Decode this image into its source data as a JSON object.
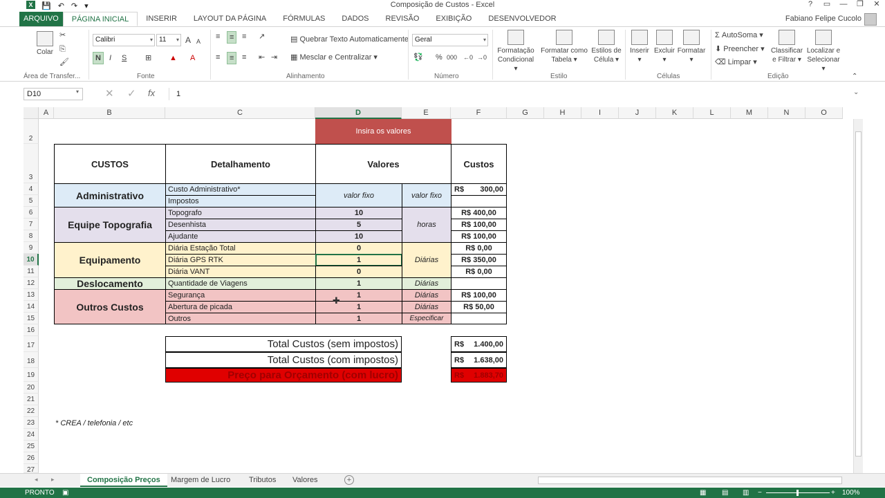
{
  "window": {
    "title": "Composição de Custos - Excel",
    "user": "Fabiano Felipe Cucolo",
    "app_badge": "X",
    "help": "?",
    "buttons": [
      "▭",
      "—",
      "❐",
      "✕"
    ]
  },
  "tabs": [
    "ARQUIVO",
    "PÁGINA INICIAL",
    "INSERIR",
    "LAYOUT DA PÁGINA",
    "FÓRMULAS",
    "DADOS",
    "REVISÃO",
    "EXIBIÇÃO",
    "DESENVOLVEDOR"
  ],
  "ribbon": {
    "paste_label": "Colar",
    "font_name": "Calibri",
    "font_size": "11",
    "wrap_text": "Quebrar Texto Automaticamente",
    "merge_center": "Mesclar e Centralizar",
    "number_format": "Geral",
    "cond_format": [
      "Formatação",
      "Condicional"
    ],
    "format_table": [
      "Formatar como",
      "Tabela"
    ],
    "cell_styles": [
      "Estilos de",
      "Célula"
    ],
    "insert": "Inserir",
    "delete": "Excluir",
    "format": "Formatar",
    "autosum": "AutoSoma",
    "fill": "Preencher",
    "clear": "Limpar",
    "sort_filter": [
      "Classificar",
      "e Filtrar"
    ],
    "find_select": [
      "Localizar e",
      "Selecionar"
    ],
    "groups": [
      "Área de Transfer...",
      "Fonte",
      "Alinhamento",
      "Número",
      "Estilo",
      "Células",
      "Edição"
    ],
    "bold": "N",
    "italic": "I",
    "underline": "S",
    "grow": "A",
    "shrink": "A",
    "percent": "%",
    "thousands": "000"
  },
  "formula_bar": {
    "name_box": "D10",
    "fx": "fx",
    "value": "1"
  },
  "columns": [
    "A",
    "B",
    "C",
    "D",
    "E",
    "F",
    "G",
    "H",
    "I",
    "J",
    "K",
    "L",
    "M",
    "N",
    "O"
  ],
  "rows": [
    "2",
    "3",
    "4",
    "5",
    "6",
    "7",
    "8",
    "9",
    "10",
    "11",
    "12",
    "13",
    "14",
    "15",
    "16",
    "17",
    "18",
    "19",
    "20",
    "21",
    "22",
    "23",
    "24",
    "25",
    "26",
    "27"
  ],
  "sheet": {
    "banner": "Insira os valores",
    "headers": {
      "custos": "CUSTOS",
      "detalhamento": "Detalhamento",
      "valores": "Valores",
      "custos_col": "Custos"
    },
    "categories": {
      "administrativo": "Administrativo",
      "equipe": "Equipe Topografia",
      "equipamento": "Equipamento",
      "deslocamento": "Deslocamento",
      "outros": "Outros Custos"
    },
    "detail": [
      "Custo Administrativo*",
      "Impostos",
      "Topografo",
      "Desenhista",
      "Ajudante",
      "Diária Estação Total",
      "Diária GPS RTK",
      "Diária VANT",
      "Quantidade de Viagens",
      "Segurança",
      "Abertura de picada",
      "Outros"
    ],
    "values": [
      "valor fixo",
      "10",
      "5",
      "10",
      "0",
      "1",
      "0",
      "1",
      "1",
      "1",
      "1"
    ],
    "units": [
      "valor fixo",
      "horas",
      "Diárias",
      "Diárias",
      "Diárias",
      "Diárias",
      "Especificar"
    ],
    "costs": [
      "R$",
      "300,00",
      "R$ 400,00",
      "R$ 100,00",
      "R$ 100,00",
      "R$ 0,00",
      "R$ 350,00",
      "R$ 0,00",
      "R$ 100,00",
      "R$ 50,00"
    ],
    "totals": {
      "sem_impostos": "Total Custos (sem impostos)",
      "com_impostos": "Total Custos (com impostos)",
      "orcamento": "Preço para Orçamento (com lucro)",
      "currency": "R$",
      "v1": "1.400,00",
      "v2": "1.638,00",
      "v3": "1.883,70"
    },
    "note": "* CREA / telefonia / etc"
  },
  "sheet_tabs": [
    "Composição Preços",
    "Margem de Lucro",
    "Tributos",
    "Valores"
  ],
  "status": {
    "mode": "PRONTO",
    "zoom": "100%"
  },
  "colors": {
    "accent": "#217346",
    "banner": "#c0504d",
    "admin": "#ddebf7",
    "equipe": "#e4dfec",
    "equip": "#fff2cc",
    "desloc": "#e2efda",
    "outros": "#f2c4c4",
    "red": "#e00000"
  }
}
